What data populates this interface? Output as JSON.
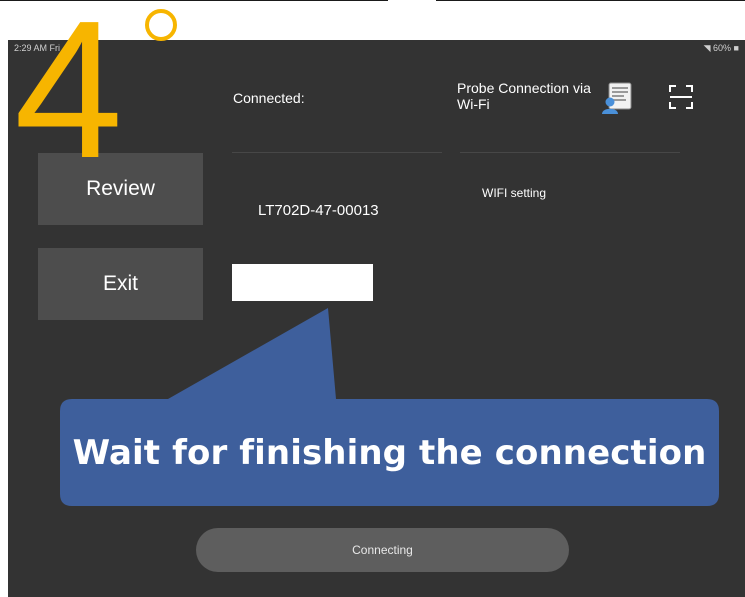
{
  "step": {
    "number": "4"
  },
  "status_bar": {
    "time": "2:29 AM  Fri",
    "battery": "◥ 60% ■"
  },
  "sidebar": {
    "review_label": "Review",
    "exit_label": "Exit"
  },
  "connection": {
    "connected_label": "Connected:",
    "device_id": "LT702D-47-00013",
    "probe_title": "Probe Connection via Wi-Fi",
    "wifi_setting_label": "WIFI setting"
  },
  "callout": {
    "text": "Wait for finishing the connection"
  },
  "connecting_button": {
    "label": "Connecting"
  },
  "colors": {
    "accent": "#f7b500",
    "callout": "#3e5f9c",
    "screen": "#333333"
  }
}
